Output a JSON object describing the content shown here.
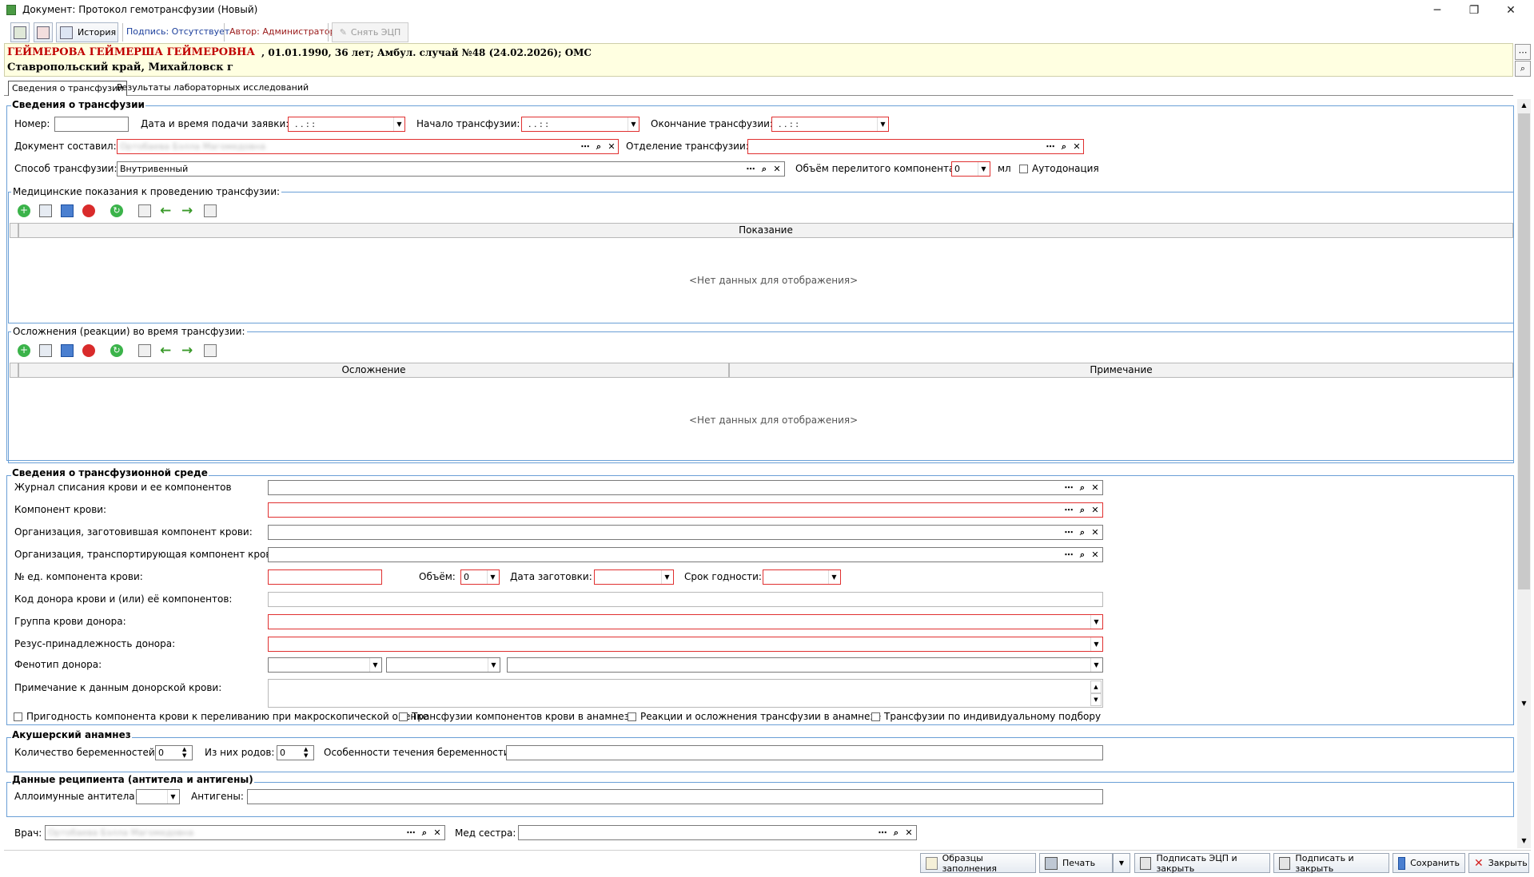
{
  "window": {
    "title": "Документ: Протокол гемотрансфузии (Новый)",
    "minimize_glyph": "─",
    "maximize_glyph": "❐",
    "close_glyph": "✕"
  },
  "toolbar": {
    "history_label": "История",
    "signature_label": "Подпись: Отсутствует",
    "author_label": "Автор: Администратор",
    "remove_ecp_label": "Снять ЭЦП"
  },
  "patient": {
    "name": "ГЕЙМЕРОВА ГЕЙМЕРША ГЕЙМЕРОВНА",
    "info": ", 01.01.1990, 36 лет; Амбул. случай №48 (24.02.2026); ОМС",
    "address": "Ставропольский край, Михайловск г"
  },
  "tabs": [
    {
      "label": "Сведения о трансфузии"
    },
    {
      "label": "Результаты лабораторных исследований"
    }
  ],
  "transfusion_info": {
    "title": "Сведения о трансфузии",
    "number_label": "Номер:",
    "request_datetime_label": "Дата и время подачи заявки:",
    "request_datetime_value": ". .      : :",
    "start_label": "Начало трансфузии:",
    "start_value": ". .      : :",
    "end_label": "Окончание трансфузии:",
    "end_value": ". .      : :",
    "author_label": "Документ составил:",
    "author_value": "Ортобаева Бэлла Магомедовна",
    "department_label": "Отделение трансфузии:",
    "method_label": "Способ трансфузии:",
    "method_value": "Внутривенный",
    "volume_label": "Объём перелитого компонента:",
    "volume_value": "0",
    "volume_unit": "мл",
    "autodonation_label": "Аутодонация"
  },
  "indications": {
    "title": "Медицинские показания к проведению трансфузии:",
    "column": "Показание",
    "empty_text": "<Нет данных для отображения>"
  },
  "complications": {
    "title": "Осложнения (реакции) во время трансфузии:",
    "columns": [
      "Осложнение",
      "Примечание"
    ],
    "empty_text": "<Нет данных для отображения>"
  },
  "medium": {
    "title": "Сведения о трансфузионной среде",
    "journal_label": "Журнал списания крови и ее компонентов",
    "component_label": "Компонент крови:",
    "org_prepared_label": "Организация, заготовившая компонент крови:",
    "org_transport_label": "Организация, транспортирующая компонент крови:",
    "unit_no_label": "№ ед. компонента крови:",
    "volume_label": "Объём:",
    "volume_value": "0",
    "prep_date_label": "Дата заготовки:",
    "expiry_label": "Срок годности:",
    "donor_code_label": "Код донора крови и (или) её компонентов:",
    "blood_group_label": "Группа крови донора:",
    "rh_label": "Резус-принадлежность донора:",
    "phenotype_label": "Фенотип донора:",
    "note_label": "Примечание к данным донорской крови:",
    "checkboxes": [
      "Пригодность компонента крови к переливанию при макроскопической оценке",
      "Трансфузии компонентов крови в анамнезе",
      "Реакции и осложнения трансфузии в анамнезе",
      "Трансфузии по индивидуальному подбору"
    ]
  },
  "obstetric": {
    "title": "Акушерский анамнез",
    "pregnancies_label": "Количество беременностей:",
    "pregnancies_value": "0",
    "births_label": "Из них родов:",
    "births_value": "0",
    "course_label": "Особенности течения беременности:"
  },
  "recipient": {
    "title": "Данные реципиента (антитела и антигены)",
    "antibodies_label": "Аллоимунные антитела:",
    "antigens_label": "Антигены:"
  },
  "staff": {
    "doctor_label": "Врач:",
    "doctor_value": "Ортобаева Бэлла Магомедовна",
    "nurse_label": "Мед сестра:"
  },
  "buttons": {
    "samples": "Образцы заполнения",
    "print": "Печать",
    "sign_ecp_close": "Подписать ЭЦП и закрыть",
    "sign_close": "Подписать и закрыть",
    "save": "Сохранить",
    "close": "Закрыть"
  },
  "colors": {
    "group_border": "#6a9fd6",
    "required_border": "#e03030",
    "patient_bg": "#ffffe1",
    "patient_name": "#c00000"
  }
}
